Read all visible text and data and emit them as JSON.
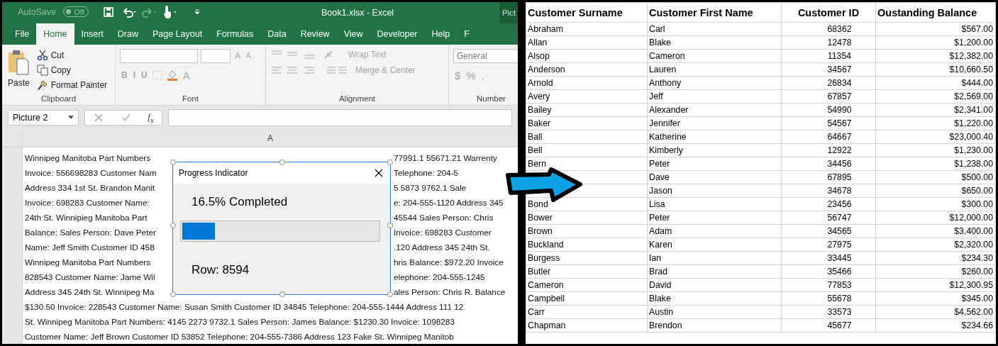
{
  "excel": {
    "autosave": {
      "label": "AutoSave",
      "state": "Off",
      "on": false
    },
    "title": "Book1.xlsx  -  Excel",
    "context_tab": "Pict",
    "tabs": [
      {
        "label": "File",
        "selected": false
      },
      {
        "label": "Home",
        "selected": true
      },
      {
        "label": "Insert",
        "selected": false
      },
      {
        "label": "Draw",
        "selected": false
      },
      {
        "label": "Page Layout",
        "selected": false
      },
      {
        "label": "Formulas",
        "selected": false
      },
      {
        "label": "Data",
        "selected": false
      },
      {
        "label": "Review",
        "selected": false
      },
      {
        "label": "View",
        "selected": false
      },
      {
        "label": "Developer",
        "selected": false
      },
      {
        "label": "Help",
        "selected": false
      },
      {
        "label": "F",
        "selected": false
      }
    ],
    "clipboard": {
      "paste": "Paste",
      "cut": "Cut",
      "copy": "Copy",
      "format_painter": "Format Painter",
      "group": "Clipboard"
    },
    "font": {
      "style_buttons": [
        "B",
        "I",
        "U"
      ],
      "color_letter": "A",
      "grow": "A",
      "shrink": "A",
      "group": "Font"
    },
    "alignment": {
      "wrap_text": "Wrap Text",
      "merge_center": "Merge & Center",
      "group": "Alignment"
    },
    "number": {
      "format": "General",
      "symbols": [
        "$",
        "%",
        ","
      ],
      "group": "Number"
    },
    "name_box": "Picture 2",
    "fx": "f$_{x}$",
    "column_header": "A",
    "sheet_lines": [
      {
        "left": "Winnipeg Manitoba Part Numbers",
        "right": "77991.1 55671.21  Warrenty"
      },
      {
        "left": "Invoice: 556698283 Customer Nam",
        "right": "Telephone: 204-5"
      },
      {
        "left": "Address 334 1st St. Brandon Manit",
        "right": "5 5873 9762.1  Sale"
      },
      {
        "left": "Invoice: 698283  Customer Name:",
        "right": "e: 204-555-1120 Address 345"
      },
      {
        "left": "24th St. Winnipieg Manitoba Part",
        "right": "45544  Sales Person: Chris"
      },
      {
        "left": "Balance: Sales Person: Dave Peter",
        "right": "Invoice: 698283 Customer"
      },
      {
        "left": "Name: Jeff Smith Customer ID 458",
        "right": ".120 Address 345 24th St."
      },
      {
        "left": "Winnipeg Manitoba Part Numbers",
        "right": "hris  Balance: $972.20 Invoice"
      },
      {
        "left": "828543 Customer Name: Jame Wil",
        "right": "elephone: 204-555-1245"
      },
      {
        "left": "Address 345 24th St. Winnipeg Ma",
        "right": "ales Person: Chris R.  Balance"
      },
      {
        "full": "$130.50 Invoice: 228543 Customer Name: Susan Smith Customer ID 34845 Telephone: 204-555-1444  Address 111 12"
      },
      {
        "full": "St. Winnipeg Manitoba Part Numbers: 4145 2273 9732.1  Sales Person: James  Balance: $1230.30  Invoice: 1098283"
      },
      {
        "full": "Customer Name: Jeff Brown Customer ID 53852 Telephone: 204-555-7386  Address 123 Fake St. Winnipeg Manitob"
      }
    ],
    "dialog": {
      "title": "Progress Indicator",
      "status": "16.5% Completed",
      "level": 0.165,
      "row": "Row: 8594"
    }
  },
  "table": {
    "columns": [
      "Customer Surname",
      "Customer First Name",
      "Customer ID",
      "Oustanding Balance"
    ],
    "rows": [
      [
        "Abraham",
        "Carl",
        "68362",
        "$567.00"
      ],
      [
        "Allan",
        "Blake",
        "12478",
        "$1,200.00"
      ],
      [
        "Alsop",
        "Cameron",
        "11354",
        "$12,382.00"
      ],
      [
        "Anderson",
        "Lauren",
        "34567",
        "$10,660.50"
      ],
      [
        "Arnold",
        "Anthony",
        "26834",
        "$444.00"
      ],
      [
        "Avery",
        "Jeff",
        "67857",
        "$2,569.00"
      ],
      [
        "Bailey",
        "Alexander",
        "54990",
        "$2,341.00"
      ],
      [
        "Baker",
        "Jennifer",
        "54567",
        "$1,220.00"
      ],
      [
        "Ball",
        "Katherine",
        "64667",
        "$23,000.40"
      ],
      [
        "Bell",
        "Kimberly",
        "12922",
        "$1,230.00"
      ],
      [
        "Bern",
        "Peter",
        "34456",
        "$1,238.00"
      ],
      [
        null,
        "Dave",
        "67895",
        "$500.00"
      ],
      [
        null,
        "Jason",
        "34678",
        "$650.00"
      ],
      [
        "Bond",
        "Lisa",
        "23456",
        "$300.00"
      ],
      [
        "Bower",
        "Peter",
        "56747",
        "$12,000.00"
      ],
      [
        "Brown",
        "Adam",
        "34565",
        "$3,400.00"
      ],
      [
        "Buckland",
        "Karen",
        "27975",
        "$2,320.00"
      ],
      [
        "Burgess",
        "Ian",
        "33445",
        "$234.30"
      ],
      [
        "Butler",
        "Brad",
        "35466",
        "$260.00"
      ],
      [
        "Cameron",
        "David",
        "77853",
        "$12,300.95"
      ],
      [
        "Campbell",
        "Blake",
        "55678",
        "$345.00"
      ],
      [
        "Carr",
        "Austin",
        "33573",
        "$4,562.00"
      ],
      [
        "Chapman",
        "Brendon",
        "45677",
        "$234.66"
      ]
    ]
  }
}
